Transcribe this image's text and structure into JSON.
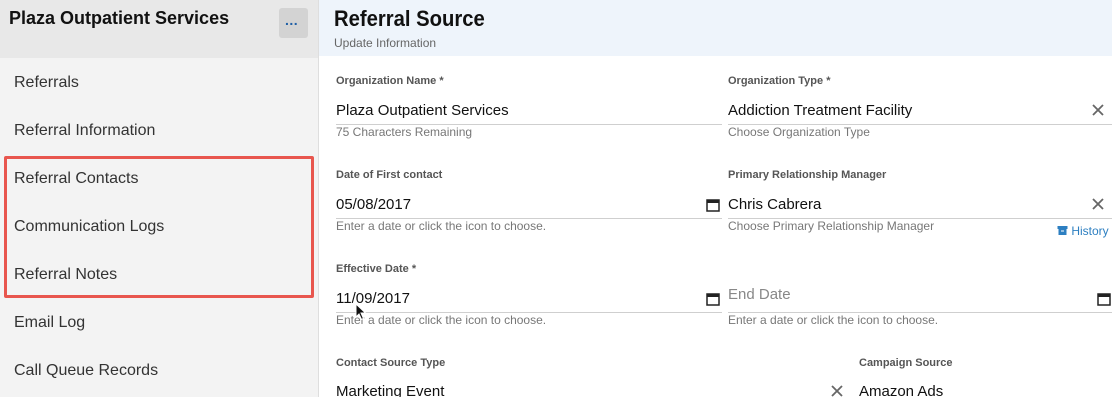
{
  "sidebar": {
    "title": "Plaza Outpatient Services",
    "more_label": "...",
    "items": [
      {
        "label": "Referrals"
      },
      {
        "label": "Referral Information"
      },
      {
        "label": "Referral Contacts"
      },
      {
        "label": "Communication Logs"
      },
      {
        "label": "Referral Notes"
      },
      {
        "label": "Email Log"
      },
      {
        "label": "Call Queue Records"
      }
    ],
    "highlight_color": "#e8564e"
  },
  "header": {
    "title": "Referral Source",
    "subtitle": "Update Information"
  },
  "form": {
    "org_name": {
      "label": "Organization Name",
      "required": "*",
      "value": "Plaza Outpatient Services",
      "hint": "75 Characters Remaining"
    },
    "org_type": {
      "label": "Organization Type",
      "required": "*",
      "value": "Addiction Treatment Facility",
      "hint": "Choose Organization Type"
    },
    "first_contact": {
      "label": "Date of First contact",
      "value": "05/08/2017",
      "hint": "Enter a date or click the icon to choose."
    },
    "relationship_manager": {
      "label": "Primary Relationship Manager",
      "value": "Chris Cabrera",
      "hint": "Choose Primary Relationship Manager",
      "history_label": "History"
    },
    "effective_date": {
      "label": "Effective Date",
      "required": "*",
      "value": "11/09/2017",
      "hint": "Enter a date or click the icon to choose."
    },
    "end_date": {
      "placeholder": "End Date",
      "hint": "Enter a date or click the icon to choose."
    },
    "contact_source_type": {
      "label": "Contact Source Type",
      "value": "Marketing Event"
    },
    "campaign_source": {
      "label": "Campaign Source",
      "value": "Amazon Ads"
    }
  },
  "colors": {
    "accent": "#2d7fc1",
    "header_bg": "#eef4fb"
  }
}
